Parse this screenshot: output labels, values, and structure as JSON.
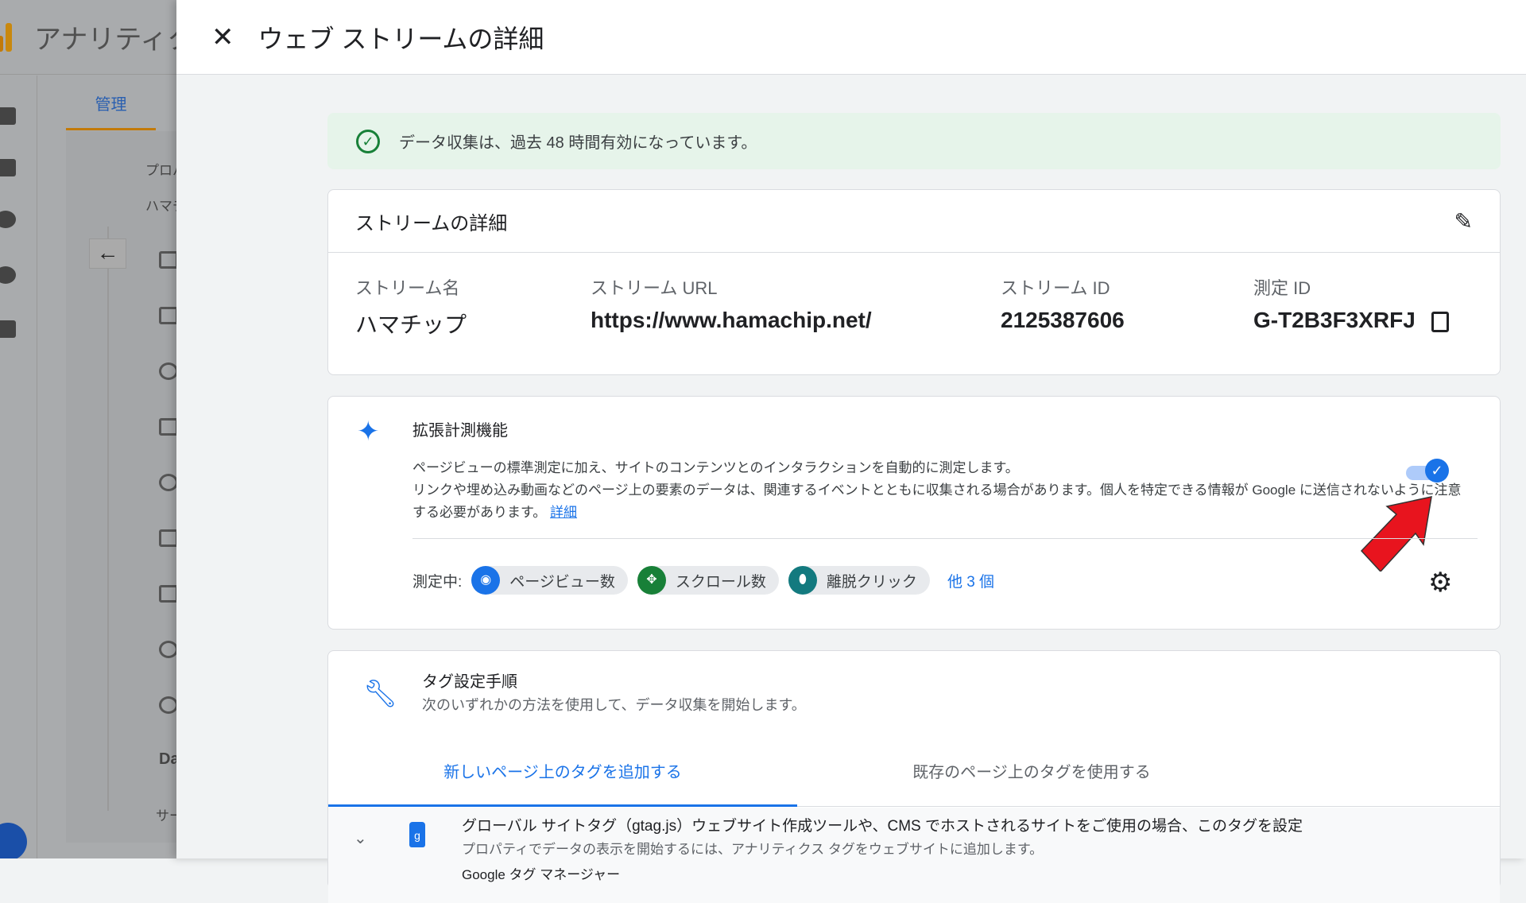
{
  "background": {
    "app_title": "アナリティクス",
    "admin_tab": "管理",
    "property_label": "プロパティ",
    "property_value": "ハマチップ",
    "item_d": "Da",
    "item_sa": "サー"
  },
  "header": {
    "close_icon": "close-icon",
    "title": "ウェブ ストリームの詳細"
  },
  "banner": {
    "text": "データ収集は、過去 48 時間有効になっています。",
    "color": "#188038"
  },
  "stream": {
    "title": "ストリームの詳細",
    "fields": [
      {
        "label": "ストリーム名",
        "value": "ハマチップ"
      },
      {
        "label": "ストリーム URL",
        "value": "https://www.hamachip.net/"
      },
      {
        "label": "ストリーム ID",
        "value": "2125387606"
      },
      {
        "label": "測定 ID",
        "value": "G-T2B3F3XRFJ"
      }
    ]
  },
  "enhanced": {
    "title": "拡張計測機能",
    "description": "ページビューの標準測定に加え、サイトのコンテンツとのインタラクションを自動的に測定します。",
    "description2": "リンクや埋め込み動画などのページ上の要素のデータは、関連するイベントとともに収集される場合があります。個人を特定できる情報が Google に送信されないように注意する必要があります。",
    "link": "詳細",
    "toggle_on": true,
    "measuring_label": "測定中:",
    "chips": [
      {
        "label": "ページビュー数",
        "icon": "eye-icon",
        "color": "#1a73e8"
      },
      {
        "label": "スクロール数",
        "icon": "scroll-icon",
        "color": "#188038"
      },
      {
        "label": "離脱クリック",
        "icon": "mouse-icon",
        "color": "#137a7f"
      }
    ],
    "more": "他 3 個"
  },
  "tagging": {
    "title": "タグ設定手順",
    "subtitle": "次のいずれかの方法を使用して、データ収集を開始します。",
    "tabs": [
      {
        "label": "新しいページ上のタグを追加する",
        "active": true
      },
      {
        "label": "既存のページ上のタグを使用する",
        "active": false
      }
    ],
    "row": {
      "title": "グローバル サイトタグ（gtag.js）ウェブサイト作成ツールや、CMS でホストされるサイトをご使用の場合、このタグを設定",
      "subtitle": "プロパティでデータの表示を開始するには、アナリティクス タグをウェブサイトに追加します。",
      "next": "Google タグ マネージャー"
    }
  },
  "accent": "#1a73e8"
}
